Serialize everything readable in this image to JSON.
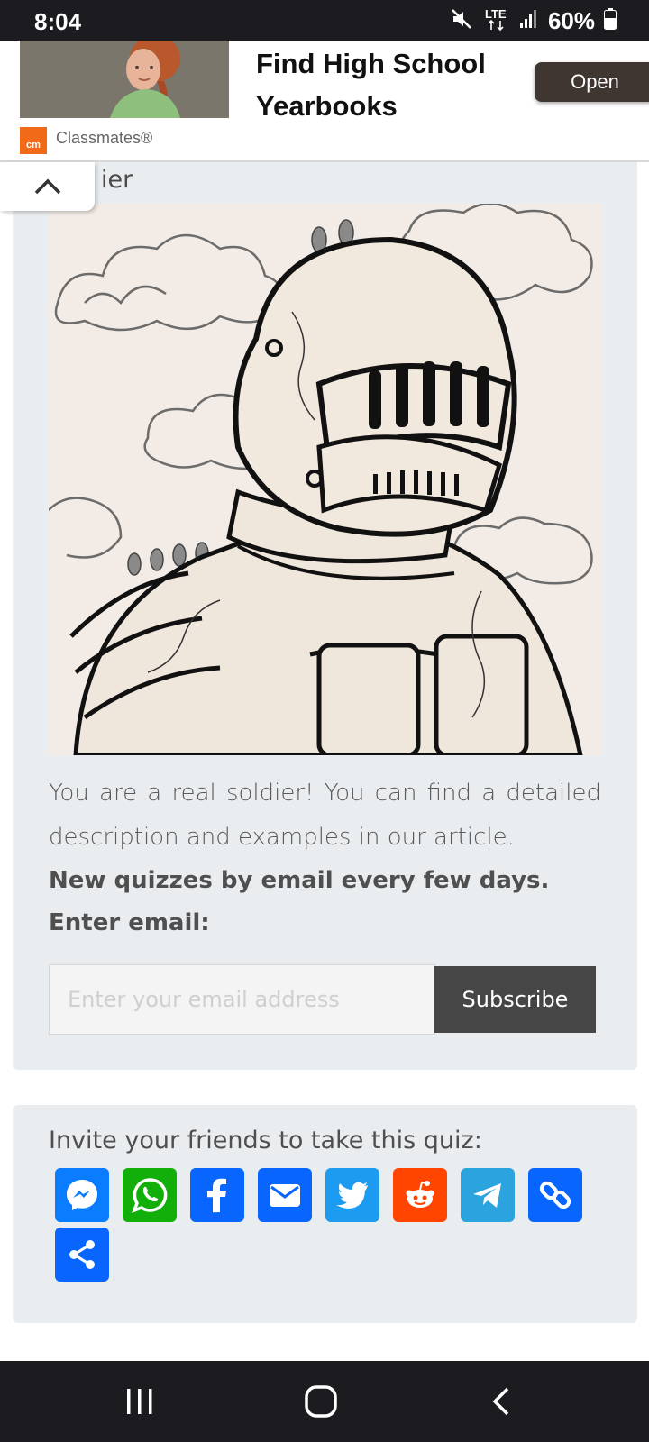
{
  "status_bar": {
    "time": "8:04",
    "network": "LTE",
    "battery": "60%",
    "icons": [
      "mute-icon",
      "lte-icon",
      "signal-icon",
      "battery-icon"
    ]
  },
  "ad": {
    "title": "Find High School Yearbooks",
    "open_label": "Open",
    "brand_logo": "cm",
    "brand_name": "Classmates®"
  },
  "result": {
    "heading_partial": "ier",
    "image_icon": "knight-armor-illustration",
    "description": "You are a real soldier! You can find a detailed description and examples in our article.",
    "newsletter_prompt": "New quizzes by email every few days. Enter email:",
    "email_placeholder": "Enter your email address",
    "subscribe_label": "Subscribe"
  },
  "share": {
    "title": "Invite your friends to take this quiz:",
    "buttons": [
      {
        "icon": "messenger-icon",
        "color": "#0a7cff"
      },
      {
        "icon": "whatsapp-icon",
        "color": "#12af0a"
      },
      {
        "icon": "facebook-icon",
        "color": "#0866ff"
      },
      {
        "icon": "email-icon",
        "color": "#0866ff"
      },
      {
        "icon": "twitter-icon",
        "color": "#1d9bf0"
      },
      {
        "icon": "reddit-icon",
        "color": "#ff4500"
      },
      {
        "icon": "telegram-icon",
        "color": "#2aa3df"
      },
      {
        "icon": "copy-link-icon",
        "color": "#0866ff"
      },
      {
        "icon": "share-icon",
        "color": "#0866ff"
      }
    ]
  },
  "nav_bar": {
    "icons": [
      "recent-apps-icon",
      "home-icon",
      "back-icon"
    ]
  }
}
